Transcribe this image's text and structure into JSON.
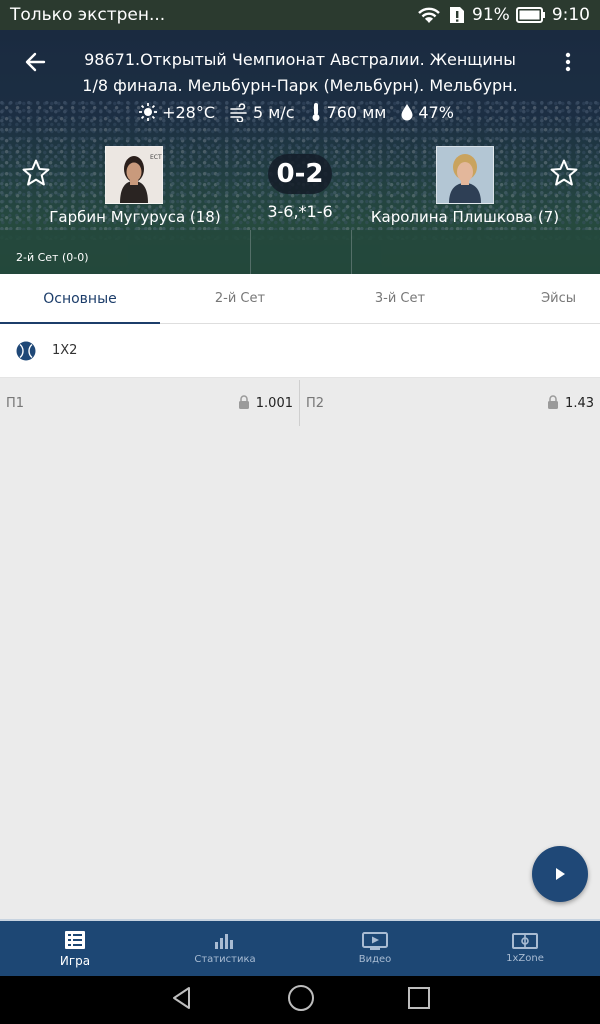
{
  "status_bar": {
    "notification": "Только экстрен...",
    "battery": "91%",
    "time": "9:10"
  },
  "header": {
    "title_line1": "98671.Открытый Чемпионат Австралии. Женщины",
    "title_line2": "1/8 финала. Мельбурн-Парк (Мельбурн). Мельбурн.",
    "weather": {
      "temperature": "+28°С",
      "wind": "5 м/с",
      "pressure": "760 мм",
      "humidity": "47%"
    },
    "score": "0-2",
    "sets": "3-6,*1-6",
    "player1": "Гарбин Мугуруса (18)",
    "player2": "Каролина Плишкова (7)",
    "set_status": "2-й  Сет (0-0)"
  },
  "tabs": [
    {
      "label": "Основные",
      "active": true
    },
    {
      "label": "2-й  Сет",
      "active": false
    },
    {
      "label": "3-й  Сет",
      "active": false
    },
    {
      "label": "Эйсы",
      "active": false
    }
  ],
  "market": {
    "name": "1X2",
    "odds": [
      {
        "name": "П1",
        "value": "1.001"
      },
      {
        "name": "П2",
        "value": "1.43"
      }
    ]
  },
  "bottom_nav": [
    {
      "label": "Игра",
      "icon": "list-icon",
      "active": true
    },
    {
      "label": "Статистика",
      "icon": "bar-chart-icon",
      "active": false
    },
    {
      "label": "Видео",
      "icon": "video-icon",
      "active": false
    },
    {
      "label": "1xZone",
      "icon": "zone-icon",
      "active": false
    }
  ],
  "colors": {
    "primary": "#1d4774",
    "accent": "#1c3d6a"
  }
}
